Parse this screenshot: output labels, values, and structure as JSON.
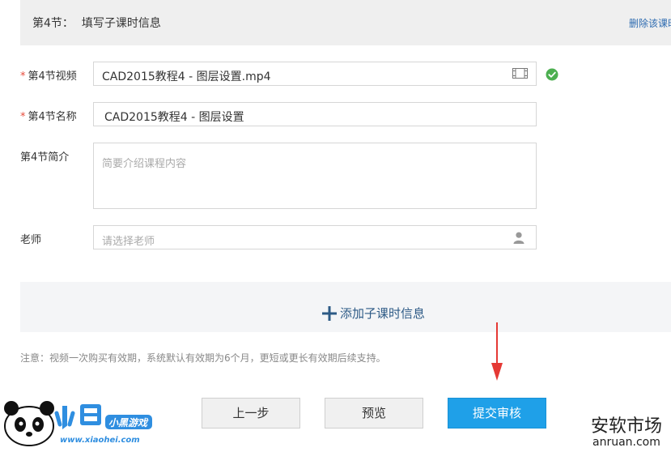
{
  "section": {
    "number_label": "第4节：",
    "title": "填写子课时信息",
    "delete_link": "删除该课时"
  },
  "form": {
    "video": {
      "label": "第4节视频",
      "required_mark": "*",
      "value": "CAD2015教程4 - 图层设置.mp4"
    },
    "name": {
      "label": "第4节名称",
      "required_mark": "*",
      "value": "CAD2015教程4 - 图层设置"
    },
    "intro": {
      "label": "第4节简介",
      "placeholder": "简要介绍课程内容"
    },
    "teacher": {
      "label": "老师",
      "placeholder": "请选择老师"
    }
  },
  "add_sub_lesson": {
    "label": "添加子课时信息"
  },
  "note": "注意：视频一次购买有效期，系统默认有效期为6个月，更短或更长有效期后续支持。",
  "buttons": {
    "prev": "上一步",
    "preview": "预览",
    "submit": "提交审核"
  },
  "watermarks": {
    "left_site": "www.xiaohei.com",
    "left_brand": "小黑游戏",
    "right_cn": "安软市场",
    "right_en": "anruan.com"
  },
  "colors": {
    "accent_blue": "#1fa0e8",
    "link_blue": "#2d6bb0",
    "required_red": "#e74c3c",
    "success_green": "#4caf50",
    "annotation_red": "#e53935"
  }
}
